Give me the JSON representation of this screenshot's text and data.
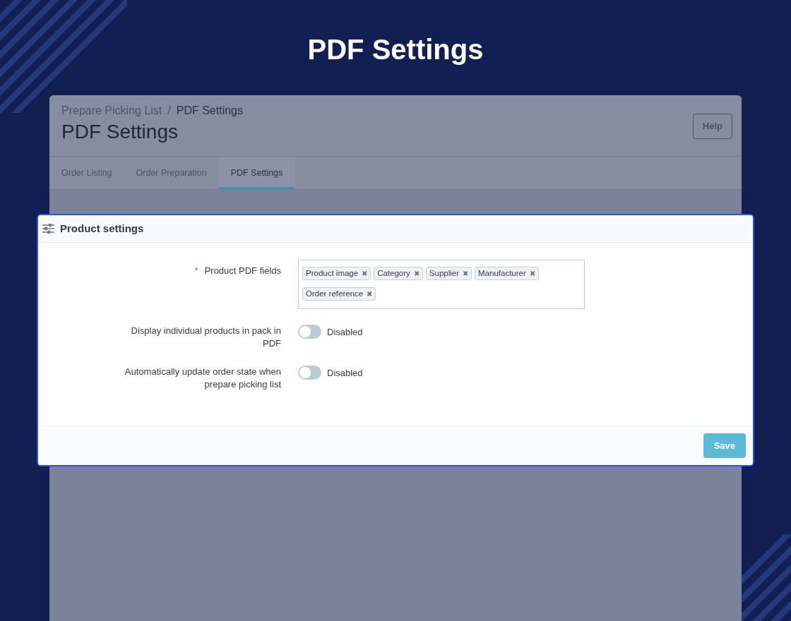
{
  "title": "PDF Settings",
  "admin_panel": {
    "breadcrumb": [
      "Prepare Picking List",
      "PDF Settings"
    ],
    "breadcrumb_separator": "/",
    "heading": "PDF Settings",
    "help_button": "Help",
    "tabs": [
      {
        "label": "Order Listing",
        "selected": false
      },
      {
        "label": "Order Preparation",
        "selected": false
      },
      {
        "label": "PDF Settings",
        "selected": true
      }
    ]
  },
  "card": {
    "title": "Product settings",
    "required_mark": "*",
    "fields": [
      {
        "kind": "tags",
        "label": "Product PDF fields",
        "required": true,
        "tags": [
          "Product image",
          "Category",
          "Supplier",
          "Manufacturer",
          "Order reference"
        ],
        "remove_mark": "✖"
      },
      {
        "kind": "switch",
        "label": "Display individual products in pack in PDF",
        "required": false,
        "on": false,
        "state_text": "Disabled"
      },
      {
        "kind": "switch",
        "label": "Automatically update order state when prepare picking list",
        "required": false,
        "on": false,
        "state_text": "Disabled"
      }
    ],
    "save_button": "Save"
  }
}
